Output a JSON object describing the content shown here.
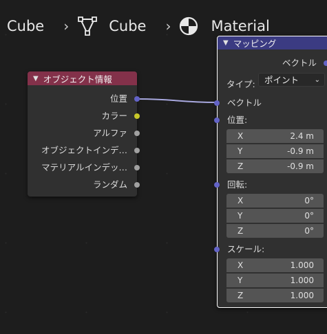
{
  "breadcrumb": {
    "item1": "Cube",
    "item2": "Cube",
    "item3": "Material",
    "separator": "›"
  },
  "object_info_node": {
    "title": "オブジェクト情報",
    "header_color": "#83314a",
    "outputs": [
      {
        "label": "位置",
        "socket_color": "#6363c7"
      },
      {
        "label": "カラー",
        "socket_color": "#c7c729"
      },
      {
        "label": "アルファ",
        "socket_color": "#a1a1a1"
      },
      {
        "label": "オブジェクトインデ…",
        "socket_color": "#a1a1a1"
      },
      {
        "label": "マテリアルインデッ…",
        "socket_color": "#a1a1a1"
      },
      {
        "label": "ランダム",
        "socket_color": "#a1a1a1"
      }
    ]
  },
  "mapping_node": {
    "title": "マッピング",
    "header_color": "#3b3b82",
    "output_label": "ベクトル",
    "type_label": "タイプ:",
    "type_value": "ポイント",
    "vector_input_label": "ベクトル",
    "location": {
      "label": "位置:",
      "x_label": "X",
      "x": "2.4 m",
      "y_label": "Y",
      "y": "-0.9 m",
      "z_label": "Z",
      "z": "-0.9 m"
    },
    "rotation": {
      "label": "回転:",
      "x_label": "X",
      "x": "0°",
      "y_label": "Y",
      "y": "0°",
      "z_label": "Z",
      "z": "0°"
    },
    "scale": {
      "label": "スケール:",
      "x_label": "X",
      "x": "1.000",
      "y_label": "Y",
      "y": "1.000",
      "z_label": "Z",
      "z": "1.000"
    }
  },
  "colors": {
    "vector_socket": "#6363c7",
    "link": "#a9a9e0",
    "selected_outline": "#ffffff"
  }
}
